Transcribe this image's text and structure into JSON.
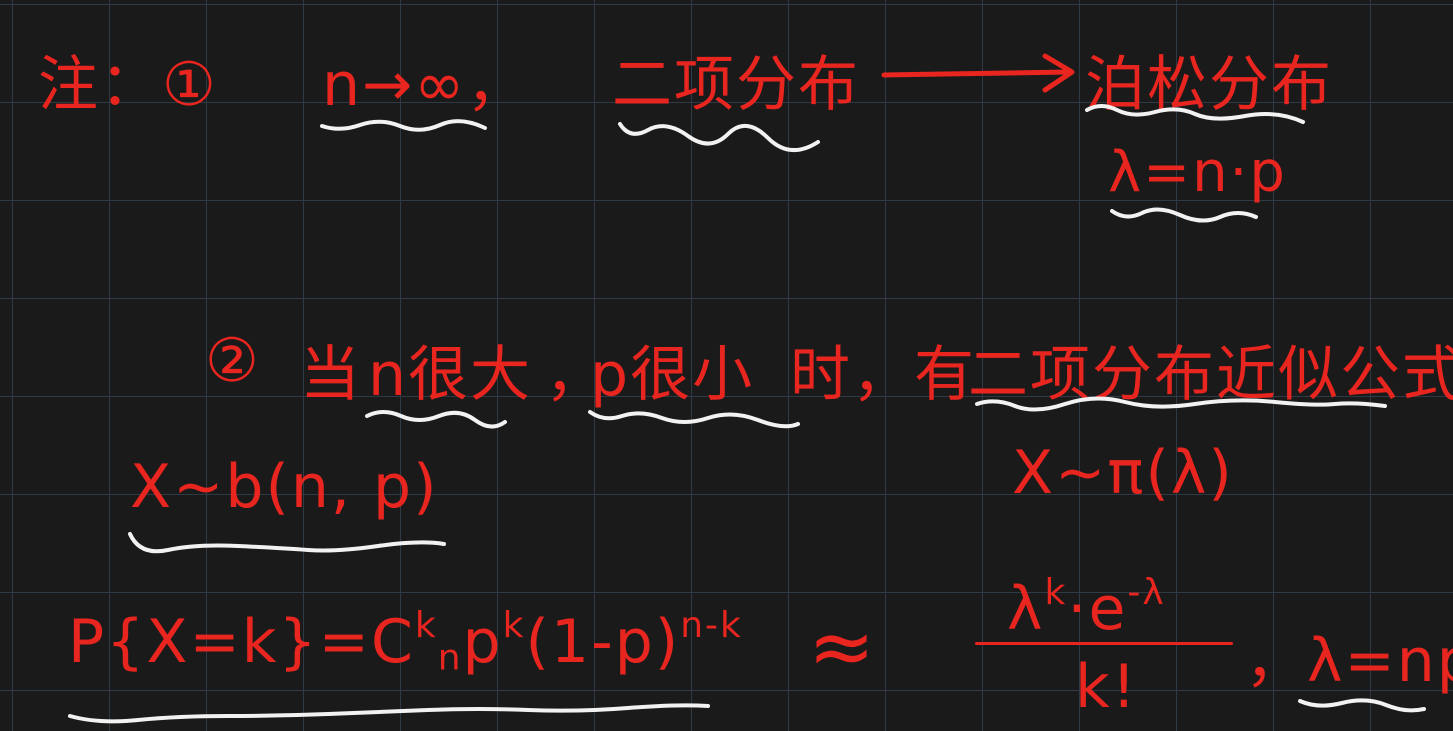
{
  "note1": {
    "prefix": "注：①",
    "condition": "n→∞，",
    "from": "二项分布",
    "to": "泊松分布",
    "lambda": "λ=n·p"
  },
  "note2": {
    "marker": "②",
    "text_a": "当",
    "n_large": "n很大",
    "sep": "，",
    "p_small": "p很小",
    "text_b": "时，有",
    "approx": "二项分布近似公式"
  },
  "binom_dist": "X~b(n, p)",
  "poisson_dist": "X~π(λ)",
  "formula": {
    "lhs": "P{X=k}=",
    "c": "C",
    "c_sup": "k",
    "c_sub": "n",
    "p": "p",
    "p_sup": "k",
    "one_minus": "(1-p)",
    "one_minus_sup": "n-k",
    "approx_sign": "≈",
    "numerator_base": "λ",
    "numerator_sup": "k",
    "numerator_mid": "·e",
    "numerator_sup2": "-λ",
    "denominator": "k!",
    "tail": "，λ=np"
  },
  "colors": {
    "ink": "#e8251f",
    "underline": "#f2f2f2",
    "board": "#1a1a1a",
    "grid": "#2e3a46"
  }
}
